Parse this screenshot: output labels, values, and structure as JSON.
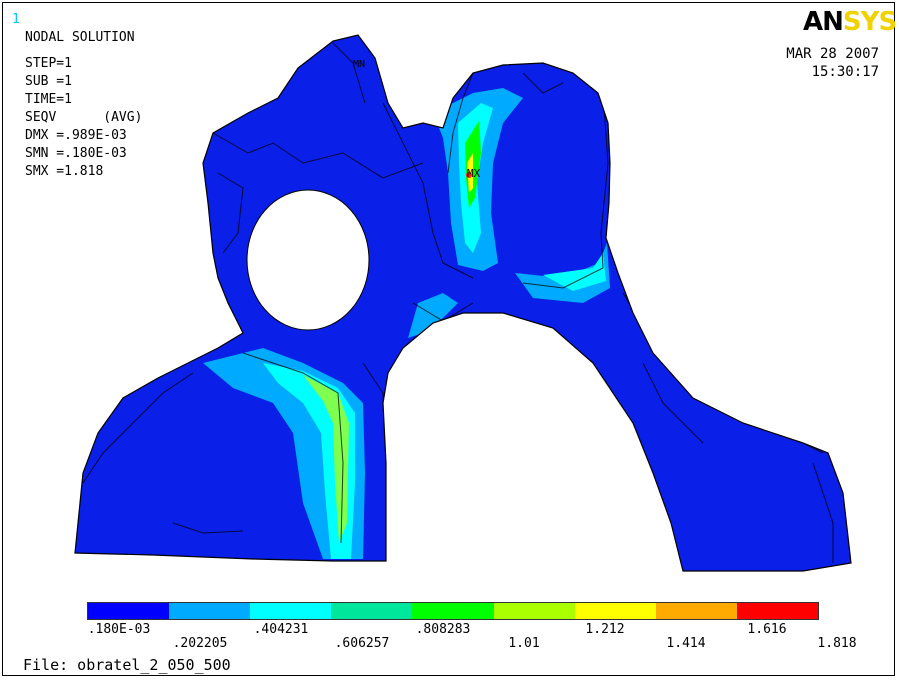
{
  "window_number": "1",
  "header": {
    "title": "NODAL SOLUTION",
    "step": "STEP=1",
    "sub": "SUB =1",
    "time": "TIME=1",
    "seqv": "SEQV      (AVG)",
    "dmx": "DMX =.989E-03",
    "smn": "SMN =.180E-03",
    "smx": "SMX =1.818"
  },
  "logo": {
    "an": "AN",
    "sys": "SYS"
  },
  "date": {
    "day": "MAR 28 2007",
    "time": "15:30:17"
  },
  "markers": {
    "max": "MX",
    "min": "MN"
  },
  "legend": {
    "colors": [
      "#0000ff",
      "#00aaff",
      "#00ffff",
      "#00e69a",
      "#00ff00",
      "#aaff00",
      "#ffff00",
      "#ffaa00",
      "#ff0000"
    ],
    "labels_top": [
      ".180E-03",
      ".404231",
      ".808283",
      "1.212",
      "1.616"
    ],
    "labels_bottom": [
      ".202205",
      ".606257",
      "1.01",
      "1.414",
      "1.818"
    ]
  },
  "footer": {
    "file": "File: obratel_2_050_500"
  }
}
